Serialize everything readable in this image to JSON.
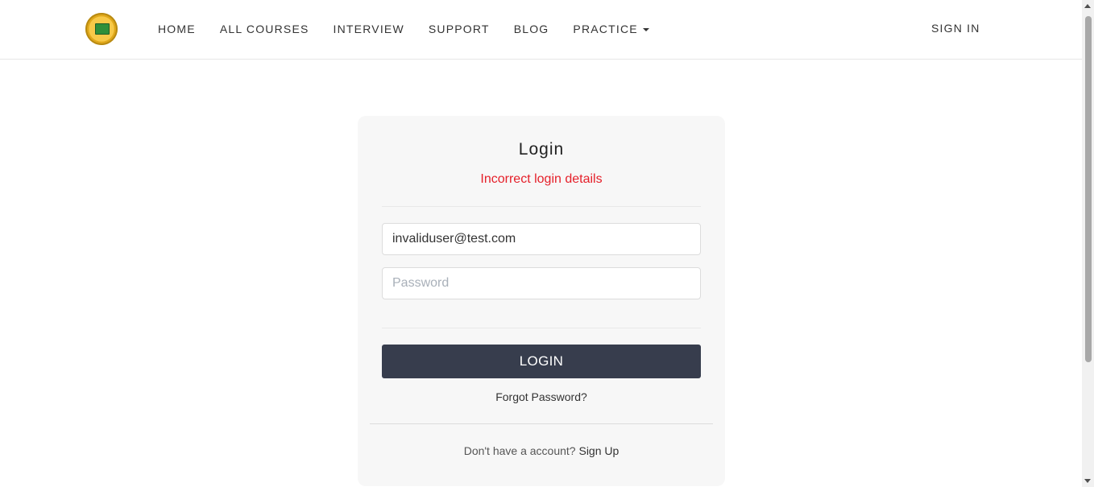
{
  "header": {
    "nav": [
      {
        "label": "HOME"
      },
      {
        "label": "ALL COURSES"
      },
      {
        "label": "INTERVIEW"
      },
      {
        "label": "SUPPORT"
      },
      {
        "label": "BLOG"
      },
      {
        "label": "PRACTICE"
      }
    ],
    "signin_label": "SIGN IN"
  },
  "login": {
    "title": "Login",
    "error": "Incorrect login details",
    "email_value": "invaliduser@test.com",
    "password_placeholder": "Password",
    "button_label": "LOGIN",
    "forgot_label": "Forgot Password?",
    "no_account_text": "Don't have a account?",
    "signup_label": "Sign Up"
  },
  "colors": {
    "error": "#e5202a",
    "button_bg": "#373d4d",
    "card_bg": "#f7f7f7"
  },
  "icons": {
    "logo": "logo-icon",
    "practice_dropdown": "caret-down-icon"
  }
}
